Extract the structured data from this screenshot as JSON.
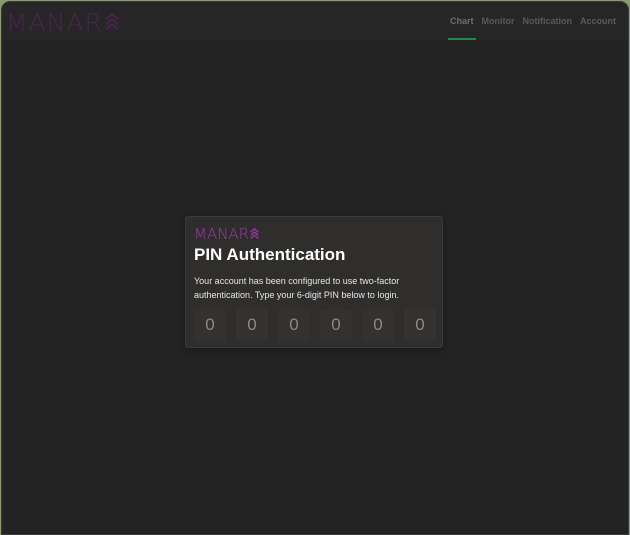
{
  "brand": {
    "name": "MANARA",
    "color": "#9b3aa6"
  },
  "nav": {
    "items": [
      {
        "label": "Chart",
        "active": true
      },
      {
        "label": "Monitor",
        "active": false
      },
      {
        "label": "Notification",
        "active": false
      },
      {
        "label": "Account",
        "active": false
      }
    ],
    "active_underline_color": "#1f8a4c"
  },
  "auth_card": {
    "title": "PIN Authentication",
    "description": "Your account has been configured to use two-factor authentication. Type your 6-digit PIN below to login.",
    "pin_placeholders": [
      "0",
      "0",
      "0",
      "0",
      "0",
      "0"
    ]
  }
}
